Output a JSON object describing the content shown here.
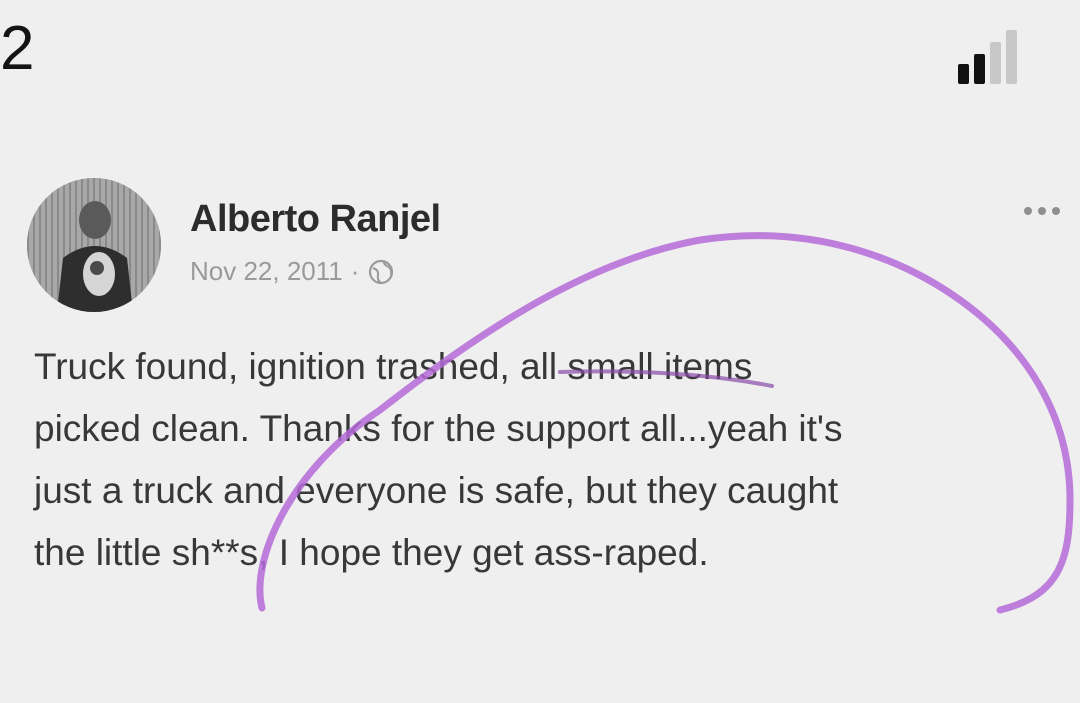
{
  "status_bar": {
    "number": "2",
    "signal_icon": "cellular-signal-icon",
    "signal_strength": 2,
    "signal_max": 4
  },
  "post": {
    "author": "Alberto Ranjel",
    "date": "Nov 22, 2011",
    "separator": "·",
    "privacy_icon": "globe-icon",
    "more_icon": "more-options-icon",
    "text_lines": [
      "Truck found, ignition trashed, all small items",
      "picked clean. Thanks for the support all...yeah it's",
      "just a truck and everyone is safe, but they caught",
      "the little sh**s, I hope they get ass-raped."
    ]
  },
  "annotation": {
    "color": "#b56ad8",
    "shape": "hand-drawn circle"
  },
  "colors": {
    "background": "#efefef",
    "author_text": "#2c2c2c",
    "meta_text": "#9a9a9a",
    "body_text": "#383838"
  }
}
